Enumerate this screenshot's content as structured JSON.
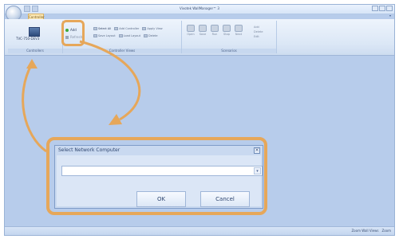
{
  "window": {
    "title": "Vivotek WallManager™ 3"
  },
  "ribbon": {
    "active_tab": "Controller",
    "controller_group": {
      "label": "Controllers",
      "controller_name": "TVC-750-DEV3",
      "add_label": "Add",
      "refresh_label": "Refresh"
    },
    "views_group": {
      "label": "Controller Views",
      "buttons_row1": [
        "Select All",
        "Add Controller",
        "Apply View"
      ],
      "buttons_row2": [
        "Save Layout",
        "Load Layout",
        "Delete"
      ]
    },
    "scenarios_group": {
      "label": "Scenarios",
      "buttons": [
        "Open",
        "Save",
        "Run",
        "Stop",
        "Next"
      ],
      "side": [
        "Add",
        "Delete",
        "Edit"
      ]
    }
  },
  "dialog": {
    "title": "Select Network Computer",
    "combo_value": "",
    "ok_label": "OK",
    "cancel_label": "Cancel"
  },
  "statusbar": {
    "right_label": "Zoom Wall Views",
    "zoom": "Zoom"
  },
  "colors": {
    "highlight": "#e6a75a",
    "background": "#b7cceb"
  },
  "icons": {
    "office_orb": "office-orb-icon",
    "close": "close-icon",
    "dropdown": "chevron-down-icon"
  }
}
